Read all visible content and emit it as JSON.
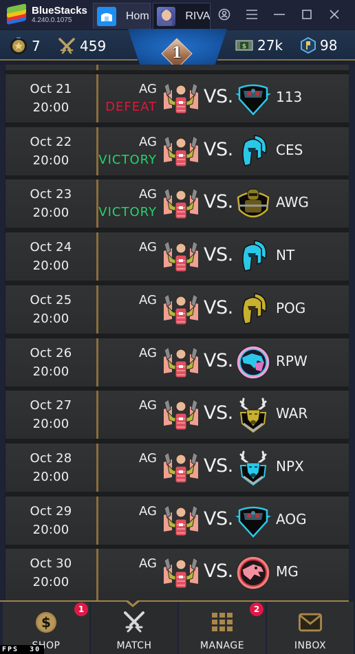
{
  "window": {
    "app_name": "BlueStacks",
    "version": "4.240.0.1075",
    "tabs": [
      {
        "label": "Hom",
        "icon": "home-icon"
      },
      {
        "label": "RIVA",
        "icon": "game-avatar-icon"
      }
    ],
    "controls": [
      "account-icon",
      "menu-icon",
      "minimize-icon",
      "maximize-icon",
      "close-icon"
    ]
  },
  "header": {
    "medal_count": "7",
    "swords_count": "459",
    "rank": "1",
    "cash": "27k",
    "tokens": "98"
  },
  "matches": [
    {
      "date": "Oct 21",
      "time": "20:00",
      "home": "AG",
      "result": "DEFEAT",
      "result_type": "defeat",
      "vs": "VS.",
      "opponent": "113",
      "opp_logo": "shield-cyan"
    },
    {
      "date": "Oct 22",
      "time": "20:00",
      "home": "AG",
      "result": "VICTORY",
      "result_type": "victory",
      "vs": "VS.",
      "opponent": "CES",
      "opp_logo": "spartan-cyan"
    },
    {
      "date": "Oct 23",
      "time": "20:00",
      "home": "AG",
      "result": "VICTORY",
      "result_type": "victory",
      "vs": "VS.",
      "opponent": "AWG",
      "opp_logo": "soldier-gold"
    },
    {
      "date": "Oct 24",
      "time": "20:00",
      "home": "AG",
      "result": "",
      "result_type": "",
      "vs": "VS.",
      "opponent": "NT",
      "opp_logo": "spartan-cyan"
    },
    {
      "date": "Oct 25",
      "time": "20:00",
      "home": "AG",
      "result": "",
      "result_type": "",
      "vs": "VS.",
      "opponent": "POG",
      "opp_logo": "spartan-gold"
    },
    {
      "date": "Oct 26",
      "time": "20:00",
      "home": "AG",
      "result": "",
      "result_type": "",
      "vs": "VS.",
      "opponent": "RPW",
      "opp_logo": "wolf-pink"
    },
    {
      "date": "Oct 27",
      "time": "20:00",
      "home": "AG",
      "result": "",
      "result_type": "",
      "vs": "VS.",
      "opponent": "WAR",
      "opp_logo": "deer-gold"
    },
    {
      "date": "Oct 28",
      "time": "20:00",
      "home": "AG",
      "result": "",
      "result_type": "",
      "vs": "VS.",
      "opponent": "NPX",
      "opp_logo": "deer-cyan"
    },
    {
      "date": "Oct 29",
      "time": "20:00",
      "home": "AG",
      "result": "",
      "result_type": "",
      "vs": "VS.",
      "opponent": "AOG",
      "opp_logo": "shield-cyan"
    },
    {
      "date": "Oct 30",
      "time": "20:00",
      "home": "AG",
      "result": "",
      "result_type": "",
      "vs": "VS.",
      "opponent": "MG",
      "opp_logo": "dragon-red"
    }
  ],
  "nav": {
    "items": [
      {
        "label": "SHOP",
        "badge": "1",
        "icon": "dollar-coin-icon"
      },
      {
        "label": "MATCH",
        "badge": "",
        "icon": "crossed-swords-icon",
        "active": true
      },
      {
        "label": "MANAGE",
        "badge": "2",
        "icon": "grid-icon"
      },
      {
        "label": "INBOX",
        "badge": "",
        "icon": "envelope-icon"
      }
    ]
  },
  "fps": {
    "label": "FPS",
    "value": "30"
  },
  "colors": {
    "victory": "#22d46a",
    "defeat": "#e01838",
    "gold": "#a08448",
    "badge": "#e01848"
  }
}
